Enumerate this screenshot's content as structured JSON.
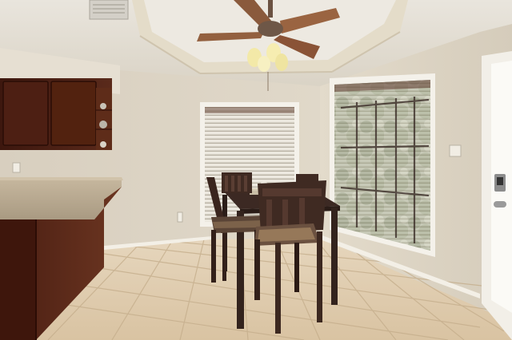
{
  "scene": {
    "kind": "photo",
    "subject": "dining nook",
    "colors": {
      "wall": "#dcd3c2",
      "ceiling": "#ebe7df",
      "floor_tile": "#e0cdb0",
      "grout": "#c7b294",
      "cabinet": "#4a1f14",
      "counter": "#b9aa90",
      "chair": "#3f2a22",
      "table": "#3c2923",
      "blind": "#e8e3d9",
      "trim": "#f4f1ea"
    }
  }
}
